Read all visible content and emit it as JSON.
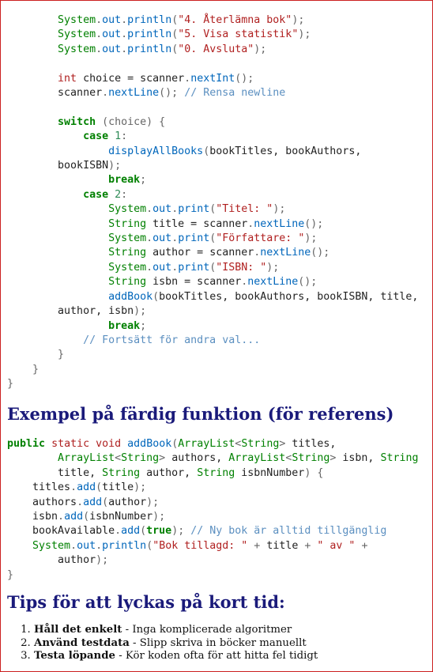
{
  "code_top": [
    [
      [
        "",
        "        "
      ],
      [
        "ty",
        "System"
      ],
      [
        "pun",
        "."
      ],
      [
        "fn",
        "out"
      ],
      [
        "pun",
        "."
      ],
      [
        "fn",
        "println"
      ],
      [
        "pun",
        "("
      ],
      [
        "str",
        "\"4. Återlämna bok\""
      ],
      [
        "pun",
        ");"
      ]
    ],
    [
      [
        "",
        "        "
      ],
      [
        "ty",
        "System"
      ],
      [
        "pun",
        "."
      ],
      [
        "fn",
        "out"
      ],
      [
        "pun",
        "."
      ],
      [
        "fn",
        "println"
      ],
      [
        "pun",
        "("
      ],
      [
        "str",
        "\"5. Visa statistik\""
      ],
      [
        "pun",
        ");"
      ]
    ],
    [
      [
        "",
        "        "
      ],
      [
        "ty",
        "System"
      ],
      [
        "pun",
        "."
      ],
      [
        "fn",
        "out"
      ],
      [
        "pun",
        "."
      ],
      [
        "fn",
        "println"
      ],
      [
        "pun",
        "("
      ],
      [
        "str",
        "\"0. Avsluta\""
      ],
      [
        "pun",
        ");"
      ]
    ],
    [
      [
        "",
        ""
      ]
    ],
    [
      [
        "",
        "        "
      ],
      [
        "kw2",
        "int"
      ],
      [
        "",
        " choice = scanner"
      ],
      [
        "pun",
        "."
      ],
      [
        "fn",
        "nextInt"
      ],
      [
        "pun",
        "();"
      ]
    ],
    [
      [
        "",
        "        scanner"
      ],
      [
        "pun",
        "."
      ],
      [
        "fn",
        "nextLine"
      ],
      [
        "pun",
        "(); "
      ],
      [
        "cm",
        "// Rensa newline"
      ]
    ],
    [
      [
        "",
        ""
      ]
    ],
    [
      [
        "",
        "        "
      ],
      [
        "kw",
        "switch"
      ],
      [
        "pun",
        " (choice) {"
      ]
    ],
    [
      [
        "",
        "            "
      ],
      [
        "kw",
        "case"
      ],
      [
        "num",
        " 1"
      ],
      [
        "pun",
        ":"
      ]
    ],
    [
      [
        "",
        "                "
      ],
      [
        "fn",
        "displayAllBooks"
      ],
      [
        "pun",
        "("
      ],
      [
        "",
        "bookTitles, bookAuthors,"
      ]
    ],
    [
      [
        "",
        "        bookISBN"
      ],
      [
        "pun",
        ");"
      ]
    ],
    [
      [
        "",
        "                "
      ],
      [
        "kw",
        "break"
      ],
      [
        "pun",
        ";"
      ]
    ],
    [
      [
        "",
        "            "
      ],
      [
        "kw",
        "case"
      ],
      [
        "num",
        " 2"
      ],
      [
        "pun",
        ":"
      ]
    ],
    [
      [
        "",
        "                "
      ],
      [
        "ty",
        "System"
      ],
      [
        "pun",
        "."
      ],
      [
        "fn",
        "out"
      ],
      [
        "pun",
        "."
      ],
      [
        "fn",
        "print"
      ],
      [
        "pun",
        "("
      ],
      [
        "str",
        "\"Titel: \""
      ],
      [
        "pun",
        ");"
      ]
    ],
    [
      [
        "",
        "                "
      ],
      [
        "ty",
        "String"
      ],
      [
        "",
        " title = scanner"
      ],
      [
        "pun",
        "."
      ],
      [
        "fn",
        "nextLine"
      ],
      [
        "pun",
        "();"
      ]
    ],
    [
      [
        "",
        "                "
      ],
      [
        "ty",
        "System"
      ],
      [
        "pun",
        "."
      ],
      [
        "fn",
        "out"
      ],
      [
        "pun",
        "."
      ],
      [
        "fn",
        "print"
      ],
      [
        "pun",
        "("
      ],
      [
        "str",
        "\"Författare: \""
      ],
      [
        "pun",
        ");"
      ]
    ],
    [
      [
        "",
        "                "
      ],
      [
        "ty",
        "String"
      ],
      [
        "",
        " author = scanner"
      ],
      [
        "pun",
        "."
      ],
      [
        "fn",
        "nextLine"
      ],
      [
        "pun",
        "();"
      ]
    ],
    [
      [
        "",
        "                "
      ],
      [
        "ty",
        "System"
      ],
      [
        "pun",
        "."
      ],
      [
        "fn",
        "out"
      ],
      [
        "pun",
        "."
      ],
      [
        "fn",
        "print"
      ],
      [
        "pun",
        "("
      ],
      [
        "str",
        "\"ISBN: \""
      ],
      [
        "pun",
        ");"
      ]
    ],
    [
      [
        "",
        "                "
      ],
      [
        "ty",
        "String"
      ],
      [
        "",
        " isbn = scanner"
      ],
      [
        "pun",
        "."
      ],
      [
        "fn",
        "nextLine"
      ],
      [
        "pun",
        "();"
      ]
    ],
    [
      [
        "",
        "                "
      ],
      [
        "fn",
        "addBook"
      ],
      [
        "pun",
        "("
      ],
      [
        "",
        "bookTitles, bookAuthors, bookISBN, title,"
      ]
    ],
    [
      [
        "",
        "        author, isbn"
      ],
      [
        "pun",
        ");"
      ]
    ],
    [
      [
        "",
        "                "
      ],
      [
        "kw",
        "break"
      ],
      [
        "pun",
        ";"
      ]
    ],
    [
      [
        "",
        "            "
      ],
      [
        "cm",
        "// Fortsätt för andra val..."
      ]
    ],
    [
      [
        "pun",
        "        }"
      ]
    ],
    [
      [
        "pun",
        "    }"
      ]
    ],
    [
      [
        "pun",
        "}"
      ]
    ]
  ],
  "heading_example": "Exempel på färdig funktion (för referens)",
  "code_example": [
    [
      [
        "kw",
        "public"
      ],
      [
        "",
        " "
      ],
      [
        "kw2",
        "static"
      ],
      [
        "",
        " "
      ],
      [
        "kw2",
        "void"
      ],
      [
        "",
        " "
      ],
      [
        "fn",
        "addBook"
      ],
      [
        "pun",
        "("
      ],
      [
        "ty",
        "ArrayList"
      ],
      [
        "pun",
        "<"
      ],
      [
        "ty",
        "String"
      ],
      [
        "pun",
        ">"
      ],
      [
        "",
        " titles,"
      ]
    ],
    [
      [
        "",
        "        "
      ],
      [
        "ty",
        "ArrayList"
      ],
      [
        "pun",
        "<"
      ],
      [
        "ty",
        "String"
      ],
      [
        "pun",
        ">"
      ],
      [
        "",
        " authors, "
      ],
      [
        "ty",
        "ArrayList"
      ],
      [
        "pun",
        "<"
      ],
      [
        "ty",
        "String"
      ],
      [
        "pun",
        ">"
      ],
      [
        "",
        " isbn, "
      ],
      [
        "ty",
        "String"
      ]
    ],
    [
      [
        "",
        "        title, "
      ],
      [
        "ty",
        "String"
      ],
      [
        "",
        " author, "
      ],
      [
        "ty",
        "String"
      ],
      [
        "",
        " isbnNumber"
      ],
      [
        "pun",
        ") {"
      ]
    ],
    [
      [
        "",
        "    titles"
      ],
      [
        "pun",
        "."
      ],
      [
        "fn",
        "add"
      ],
      [
        "pun",
        "("
      ],
      [
        "",
        "title"
      ],
      [
        "pun",
        ");"
      ]
    ],
    [
      [
        "",
        "    authors"
      ],
      [
        "pun",
        "."
      ],
      [
        "fn",
        "add"
      ],
      [
        "pun",
        "("
      ],
      [
        "",
        "author"
      ],
      [
        "pun",
        ");"
      ]
    ],
    [
      [
        "",
        "    isbn"
      ],
      [
        "pun",
        "."
      ],
      [
        "fn",
        "add"
      ],
      [
        "pun",
        "("
      ],
      [
        "",
        "isbnNumber"
      ],
      [
        "pun",
        ");"
      ]
    ],
    [
      [
        "",
        "    bookAvailable"
      ],
      [
        "pun",
        "."
      ],
      [
        "fn",
        "add"
      ],
      [
        "pun",
        "("
      ],
      [
        "kw",
        "true"
      ],
      [
        "pun",
        "); "
      ],
      [
        "cm",
        "// Ny bok är alltid tillgänglig"
      ]
    ],
    [
      [
        "",
        "    "
      ],
      [
        "ty",
        "System"
      ],
      [
        "pun",
        "."
      ],
      [
        "fn",
        "out"
      ],
      [
        "pun",
        "."
      ],
      [
        "fn",
        "println"
      ],
      [
        "pun",
        "("
      ],
      [
        "str",
        "\"Bok tillagd: \""
      ],
      [
        "pun",
        " + "
      ],
      [
        "",
        "title"
      ],
      [
        "pun",
        " + "
      ],
      [
        "str",
        "\" av \""
      ],
      [
        "pun",
        " +"
      ]
    ],
    [
      [
        "",
        "        author"
      ],
      [
        "pun",
        ");"
      ]
    ],
    [
      [
        "pun",
        "}"
      ]
    ]
  ],
  "heading_tips": "Tips för att lyckas på kort tid:",
  "tips": [
    {
      "bold": "Håll det enkelt",
      "text": " - Inga komplicerade algoritmer"
    },
    {
      "bold": "Använd testdata",
      "text": " - Slipp skriva in böcker manuellt"
    },
    {
      "bold": "Testa löpande",
      "text": " - Kör koden ofta för att hitta fel tidigt"
    }
  ]
}
